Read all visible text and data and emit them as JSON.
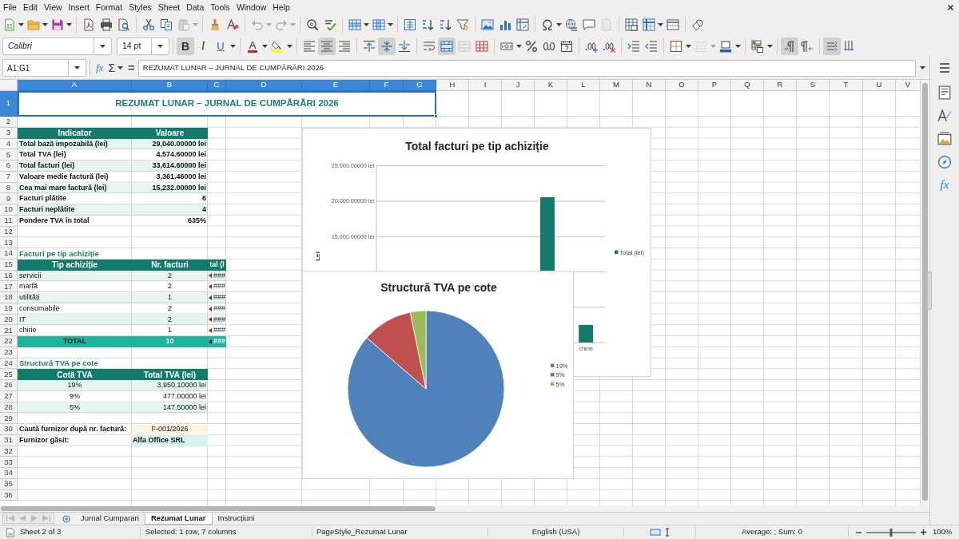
{
  "menu_bar": {
    "items": [
      "File",
      "Edit",
      "View",
      "Insert",
      "Format",
      "Styles",
      "Sheet",
      "Data",
      "Tools",
      "Window",
      "Help"
    ]
  },
  "standard_toolbar": {
    "groups": [
      [
        {
          "kind": "new",
          "disabled": false
        },
        {
          "kind": "open",
          "disabled": false
        },
        {
          "kind": "save",
          "disabled": false
        }
      ],
      [
        {
          "kind": "pdf",
          "disabled": false
        },
        {
          "kind": "print",
          "disabled": false
        },
        {
          "kind": "preview",
          "disabled": false
        }
      ],
      [
        {
          "kind": "cut",
          "disabled": false
        },
        {
          "kind": "copy",
          "disabled": false
        },
        {
          "kind": "paste",
          "disabled": true
        }
      ],
      [
        {
          "kind": "clone",
          "disabled": false
        },
        {
          "kind": "eraser",
          "disabled": false
        }
      ],
      [
        {
          "kind": "undo",
          "disabled": true
        },
        {
          "kind": "redo",
          "disabled": true
        }
      ],
      [
        {
          "kind": "find",
          "disabled": false
        },
        {
          "kind": "spelling",
          "disabled": false
        }
      ],
      [
        {
          "kind": "rows",
          "disabled": false
        },
        {
          "kind": "columns",
          "disabled": false
        }
      ],
      [
        {
          "kind": "sort",
          "disabled": false
        },
        {
          "kind": "ascending",
          "disabled": false
        },
        {
          "kind": "descending",
          "disabled": false
        },
        {
          "kind": "filter",
          "disabled": false
        }
      ],
      [
        {
          "kind": "image",
          "disabled": false
        },
        {
          "kind": "chart",
          "disabled": false
        },
        {
          "kind": "pivot",
          "disabled": false
        }
      ],
      [
        {
          "kind": "special",
          "disabled": false
        },
        {
          "kind": "hyperlink",
          "disabled": false
        },
        {
          "kind": "comment",
          "disabled": false
        },
        {
          "kind": "headers",
          "disabled": true
        }
      ],
      [
        {
          "kind": "printarea",
          "disabled": false
        },
        {
          "kind": "freeze",
          "disabled": false
        },
        {
          "kind": "split",
          "disabled": false
        }
      ],
      [
        {
          "kind": "shapes",
          "disabled": false
        }
      ]
    ]
  },
  "formatting_toolbar": {
    "font_name": "Calibri",
    "font_size": "14 pt",
    "groups": [
      [
        {
          "kind": "bold",
          "label": "B",
          "on": true,
          "disabled": false
        },
        {
          "kind": "italic",
          "label": "I",
          "on": false,
          "disabled": false
        },
        {
          "kind": "underline",
          "label": "U",
          "on": false,
          "disabled": false
        }
      ],
      [
        {
          "kind": "fontcolor",
          "label": "A",
          "on": false,
          "disabled": false
        },
        {
          "kind": "highlight",
          "on": false,
          "disabled": false
        }
      ],
      [
        {
          "kind": "left",
          "on": false,
          "disabled": false
        },
        {
          "kind": "center",
          "on": true,
          "disabled": false
        },
        {
          "kind": "right",
          "on": false,
          "disabled": false
        }
      ],
      [
        {
          "kind": "top",
          "on": false,
          "disabled": false
        },
        {
          "kind": "middle",
          "on": true,
          "disabled": false
        },
        {
          "kind": "bottom",
          "on": false,
          "disabled": false
        }
      ],
      [
        {
          "kind": "wrap",
          "on": false,
          "disabled": false
        },
        {
          "kind": "mergecenter",
          "on": true,
          "disabled": false
        },
        {
          "kind": "merge",
          "on": false,
          "disabled": true
        },
        {
          "kind": "unmerge",
          "on": false,
          "disabled": false
        }
      ],
      [
        {
          "kind": "currency",
          "on": false,
          "disabled": false
        },
        {
          "kind": "percent",
          "on": false,
          "disabled": false
        },
        {
          "kind": "number",
          "on": false,
          "disabled": false
        },
        {
          "kind": "date",
          "on": false,
          "disabled": false
        }
      ],
      [
        {
          "kind": "adddecimal",
          "on": false,
          "disabled": false
        },
        {
          "kind": "deldecimal",
          "on": false,
          "disabled": false
        }
      ],
      [
        {
          "kind": "indent",
          "on": false,
          "disabled": false
        },
        {
          "kind": "outdent",
          "on": false,
          "disabled": false
        }
      ],
      [
        {
          "kind": "borders",
          "on": false,
          "disabled": false
        },
        {
          "kind": "borderstyle",
          "on": false,
          "disabled": true
        },
        {
          "kind": "bordercolor",
          "on": false,
          "disabled": false
        }
      ],
      [
        {
          "kind": "conditional",
          "on": false,
          "disabled": false
        }
      ],
      [
        {
          "kind": "ltr",
          "on": true,
          "disabled": false
        },
        {
          "kind": "rtl",
          "on": false,
          "disabled": false
        }
      ],
      [
        {
          "kind": "textltr",
          "on": true,
          "disabled": false
        },
        {
          "kind": "textttb",
          "on": false,
          "disabled": false
        }
      ]
    ]
  },
  "formula_bar": {
    "name_box": "A1:G1",
    "function_wizard": "fx",
    "sum": "Σ",
    "equals": "=",
    "content": "REZUMAT LUNAR – JURNAL DE CUMPĂRĂRI 2026"
  },
  "sheet": {
    "columns": [
      {
        "label": "A",
        "selected": true
      },
      {
        "label": "B",
        "selected": true
      },
      {
        "label": "C",
        "selected": true
      },
      {
        "label": "D",
        "selected": true
      },
      {
        "label": "E",
        "selected": true
      },
      {
        "label": "F",
        "selected": true
      },
      {
        "label": "G",
        "selected": true
      },
      {
        "label": "H",
        "selected": false
      },
      {
        "label": "I",
        "selected": false
      },
      {
        "label": "J",
        "selected": false
      },
      {
        "label": "K",
        "selected": false
      },
      {
        "label": "L",
        "selected": false
      },
      {
        "label": "M",
        "selected": false
      },
      {
        "label": "N",
        "selected": false
      },
      {
        "label": "O",
        "selected": false
      },
      {
        "label": "P",
        "selected": false
      },
      {
        "label": "Q",
        "selected": false
      },
      {
        "label": "R",
        "selected": false
      },
      {
        "label": "S",
        "selected": false
      },
      {
        "label": "T",
        "selected": false
      },
      {
        "label": "U",
        "selected": false
      },
      {
        "label": "V",
        "selected": false
      }
    ],
    "rows": [
      {
        "label": "1",
        "selected": true
      },
      {
        "label": "2",
        "selected": false
      },
      {
        "label": "3",
        "selected": false
      },
      {
        "label": "4",
        "selected": false
      },
      {
        "label": "5",
        "selected": false
      },
      {
        "label": "6",
        "selected": false
      },
      {
        "label": "7",
        "selected": false
      },
      {
        "label": "8",
        "selected": false
      },
      {
        "label": "9",
        "selected": false
      },
      {
        "label": "10",
        "selected": false
      },
      {
        "label": "11",
        "selected": false
      },
      {
        "label": "12",
        "selected": false
      },
      {
        "label": "13",
        "selected": false
      },
      {
        "label": "14",
        "selected": false
      },
      {
        "label": "15",
        "selected": false
      },
      {
        "label": "16",
        "selected": false
      },
      {
        "label": "17",
        "selected": false
      },
      {
        "label": "18",
        "selected": false
      },
      {
        "label": "19",
        "selected": false
      },
      {
        "label": "20",
        "selected": false
      },
      {
        "label": "21",
        "selected": false
      },
      {
        "label": "22",
        "selected": false
      },
      {
        "label": "23",
        "selected": false
      },
      {
        "label": "24",
        "selected": false
      },
      {
        "label": "25",
        "selected": false
      },
      {
        "label": "26",
        "selected": false
      },
      {
        "label": "27",
        "selected": false
      },
      {
        "label": "28",
        "selected": false
      },
      {
        "label": "29",
        "selected": false
      },
      {
        "label": "30",
        "selected": false
      },
      {
        "label": "31",
        "selected": false
      },
      {
        "label": "32",
        "selected": false
      },
      {
        "label": "33",
        "selected": false
      },
      {
        "label": "34",
        "selected": false
      },
      {
        "label": "35",
        "selected": false
      },
      {
        "label": "36",
        "selected": false
      }
    ],
    "title": {
      "text": "REZUMAT LUNAR – JURNAL DE CUMPĂRĂRI 2026",
      "selected": true
    },
    "summary": {
      "columns": [
        "Indicator",
        "Valoare"
      ],
      "rows": [
        [
          "Total bază impozabilă (lei)",
          "29,040.00000 lei"
        ],
        [
          "Total TVA (lei)",
          "4,574.60000 lei"
        ],
        [
          "Total facturi (lei)",
          "33,614.60000 lei"
        ],
        [
          "Valoare medie factură (lei)",
          "3,361.46000 lei"
        ],
        [
          "Cea mai mare factură (lei)",
          "15,232.00000 lei"
        ],
        [
          "Facturi plătite",
          "6"
        ],
        [
          "Facturi neplătite",
          "4"
        ],
        [
          "Pondere TVA în total",
          "635%"
        ]
      ]
    },
    "by_type": {
      "heading": "Facturi pe tip achiziție",
      "columns": [
        "Tip achiziție",
        "Nr. facturi",
        "tal (l"
      ],
      "rows": [
        [
          "servicii",
          "2",
          "###"
        ],
        [
          "marfă",
          "2",
          "###"
        ],
        [
          "utilități",
          "1",
          "###"
        ],
        [
          "consumabile",
          "2",
          "###"
        ],
        [
          "IT",
          "2",
          "###"
        ],
        [
          "chirie",
          "1",
          "###"
        ]
      ],
      "total": [
        "TOTAL",
        "10",
        "###"
      ]
    },
    "vat": {
      "heading": "Structură TVA pe cote",
      "columns": [
        "Cotă TVA",
        "Total TVA (lei)"
      ],
      "rows": [
        [
          "19%",
          "3,950.10000 lei"
        ],
        [
          "9%",
          "477.00000 lei"
        ],
        [
          "5%",
          "147.50000 lei"
        ]
      ]
    },
    "lookup": [
      {
        "kind": "input",
        "label": "Caută furnizor după nr. factură:",
        "value": "F-001/2026"
      },
      {
        "kind": "result",
        "label": "Furnizor găsit:",
        "value": "Alfa Office SRL"
      }
    ],
    "bar_chart": {
      "chart_data": {
        "type": "bar",
        "title": "Total facturi pe tip achiziție",
        "ylabel": "Lei",
        "categories": [
          "chirie"
        ],
        "ylim": [
          0,
          25000
        ],
        "yticks": [
          {
            "value": 15000,
            "label": "15,000.00000 lei"
          },
          {
            "value": 20000,
            "label": "20,000.00000 lei"
          },
          {
            "value": 25000,
            "label": "25,000.00000 lei"
          }
        ],
        "series": [
          {
            "name": "Total (lei)",
            "color": "#157a6c",
            "values": [
              2500
            ]
          }
        ],
        "legend": "right"
      }
    },
    "pie_chart": {
      "chart_data": {
        "type": "pie",
        "title": "Structură TVA pe cote",
        "categories": [
          "19%",
          "9%",
          "5%"
        ],
        "series": [
          {
            "values": [
              86.35,
              10.43,
              3.22
            ],
            "colors": [
              "#4f81bd",
              "#c0504d",
              "#9bbb59"
            ]
          }
        ],
        "legend": "right"
      }
    }
  },
  "sheet_navigation": [
    {
      "disabled": true
    },
    {
      "disabled": true
    },
    {
      "disabled": true
    },
    {
      "disabled": true
    }
  ],
  "sheet_tabs": [
    {
      "label": "Jurnal Cumparari",
      "selected": false
    },
    {
      "label": "Rezumat Lunar",
      "selected": true
    },
    {
      "label": "Instrucțiuni",
      "selected": false
    }
  ],
  "status_bar": {
    "sheet": "Sheet 2 of 3",
    "selection": "Selected: 1 row, 7 columns",
    "page_style": "PageStyle_Rezumat Lunar",
    "language": "English (USA)",
    "summary": "Average: ; Sum: 0",
    "zoom": {
      "level": 0.5,
      "reading": "100%"
    }
  },
  "sidebar": {
    "functions_label": "fx"
  }
}
